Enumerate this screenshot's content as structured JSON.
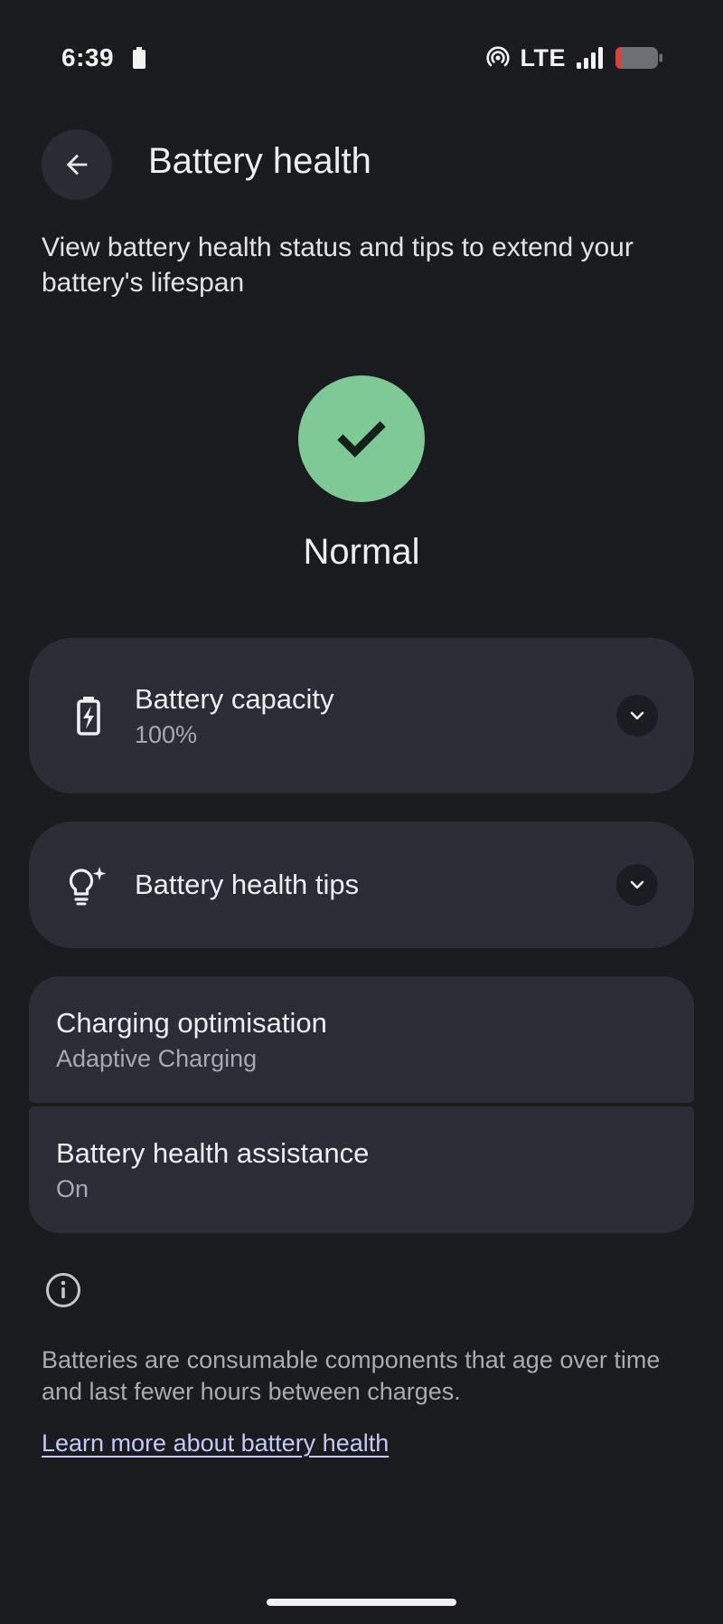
{
  "status_bar": {
    "time": "6:39",
    "network": "LTE",
    "icons": [
      "battery-saver-mini-icon",
      "hotspot-icon",
      "signal-icon",
      "battery-icon"
    ]
  },
  "header": {
    "back_icon": "arrow-back-icon",
    "title": "Battery health"
  },
  "description": "View battery health status and tips to extend your battery's lifespan",
  "health_status": {
    "icon": "check-icon",
    "label": "Normal",
    "color": "#7fc996"
  },
  "cards": {
    "capacity": {
      "icon": "battery-charging-icon",
      "title": "Battery capacity",
      "value": "100%"
    },
    "tips": {
      "icon": "lightbulb-sparkle-icon",
      "title": "Battery health tips"
    },
    "charging": {
      "title": "Charging optimisation",
      "value": "Adaptive Charging"
    },
    "assistance": {
      "title": "Battery health assistance",
      "value": "On"
    }
  },
  "footer": {
    "info_icon": "info-icon",
    "text": "Batteries are consumable components that age over time and last fewer hours between charges.",
    "link": "Learn more about battery health"
  },
  "colors": {
    "background": "#1a1b1f",
    "card": "#2b2c36",
    "accent_green": "#7fc996",
    "link": "#c6c8f6",
    "battery_low": "#e0403a"
  }
}
